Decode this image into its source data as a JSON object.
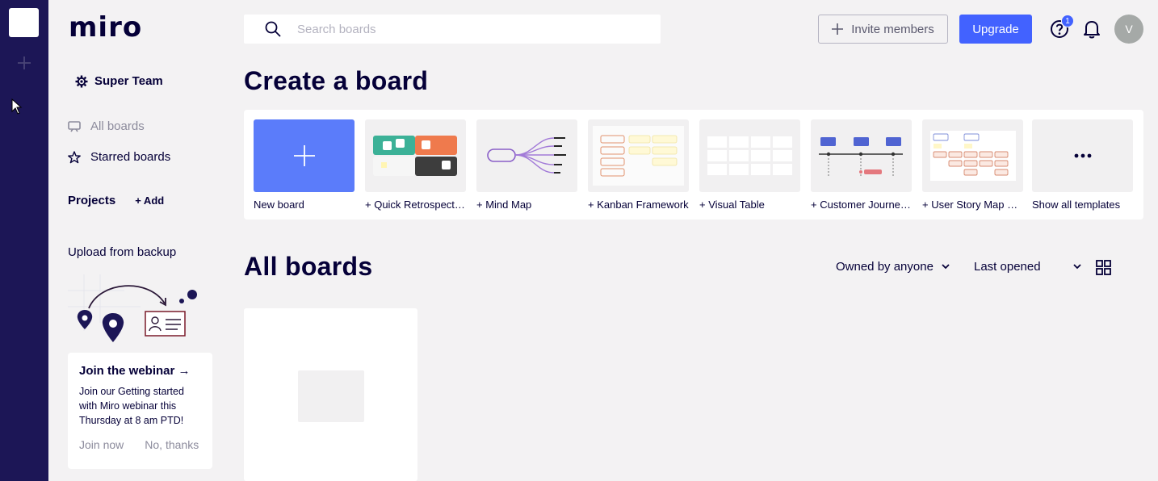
{
  "app": {
    "logo": "miro",
    "team_name": "Super Team"
  },
  "sidebar": {
    "nav": [
      {
        "label": "All boards",
        "icon": "board-icon",
        "active": true
      },
      {
        "label": "Starred boards",
        "icon": "star-icon",
        "active": false
      }
    ],
    "projects_label": "Projects",
    "projects_add": "+ Add",
    "upload_label": "Upload from backup",
    "webinar": {
      "title": "Join the webinar →",
      "description": "Join our Getting started with Miro webinar this Thursday at 8 am PTD!",
      "join_label": "Join now",
      "dismiss_label": "No, thanks"
    }
  },
  "topbar": {
    "search_placeholder": "Search boards",
    "invite_label": "Invite members",
    "upgrade_label": "Upgrade",
    "help_badge": "1",
    "avatar_initial": "V"
  },
  "create": {
    "title": "Create a board",
    "templates": [
      {
        "label": "New board",
        "kind": "new"
      },
      {
        "label": "+ Quick Retrospective",
        "kind": "retro"
      },
      {
        "label": "+ Mind Map",
        "kind": "mindmap"
      },
      {
        "label": "+ Kanban Framework",
        "kind": "kanban"
      },
      {
        "label": "+ Visual Table",
        "kind": "table"
      },
      {
        "label": "+ Customer Journey Map",
        "kind": "journey"
      },
      {
        "label": "+ User Story Map Framework",
        "kind": "storymap"
      },
      {
        "label": "Show all templates",
        "kind": "more"
      }
    ]
  },
  "boards": {
    "title": "All boards",
    "owner_filter": "Owned by anyone",
    "sort_filter": "Last opened"
  },
  "colors": {
    "rail": "#1c1656",
    "accent": "#4262ff",
    "new_board_tile": "#5b7cfa",
    "text": "#050038"
  }
}
